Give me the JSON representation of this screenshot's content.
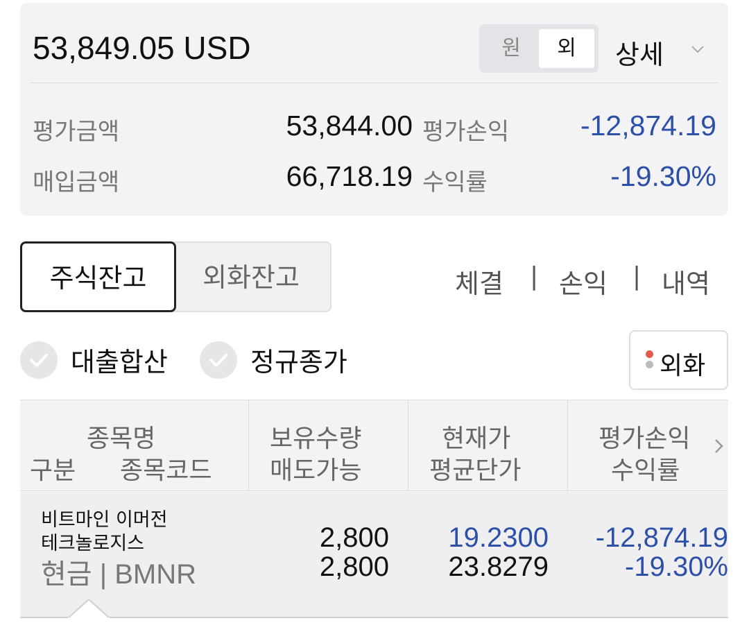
{
  "summary": {
    "total": "53,849.05 USD",
    "toggle": {
      "won": "원",
      "foreign": "외"
    },
    "detail_label": "상세",
    "rows": [
      {
        "label": "평가금액",
        "value": "53,844.00",
        "label2": "평가손익",
        "value2": "-12,874.19"
      },
      {
        "label": "매입금액",
        "value": "66,718.19",
        "label2": "수익률",
        "value2": "-19.30%"
      }
    ]
  },
  "tabs": {
    "stock": "주식잔고",
    "fx": "외화잔고"
  },
  "links": {
    "exec": "체결",
    "pnl": "손익",
    "history": "내역",
    "sep": "|"
  },
  "options": {
    "loan_sum": "대출합산",
    "regular_close": "정규종가",
    "fx_button": "외화"
  },
  "table": {
    "headers": {
      "name_top": "종목명",
      "type": "구분",
      "code": "종목코드",
      "qty": "보유수량",
      "sellable": "매도가능",
      "price": "현재가",
      "avg": "평균단가",
      "pnl": "평가손익",
      "rate": "수익률"
    },
    "rows": [
      {
        "name_line1": "비트마인 이머전",
        "name_line2": "테크놀로지스",
        "type_code": "현금 | BMNR",
        "qty": "2,800",
        "sellable": "2,800",
        "price": "19.2300",
        "avg": "23.8279",
        "pnl": "-12,874.19",
        "rate": "-19.30%"
      }
    ]
  },
  "colors": {
    "negative": "#2c4fa8",
    "card_bg": "#f3f3f5",
    "accent_dot": "#e35a4d"
  }
}
